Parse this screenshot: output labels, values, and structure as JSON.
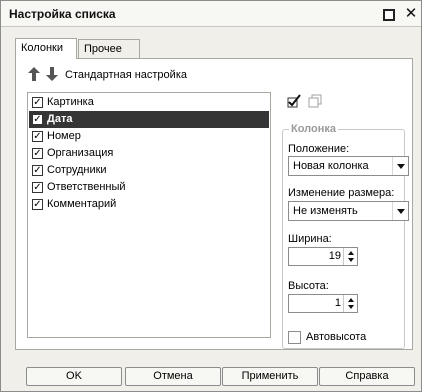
{
  "window": {
    "title": "Настройка списка",
    "maximize_icon": "maximize-icon",
    "close_icon": "close-icon",
    "close_glyph": "✕"
  },
  "tabs": [
    {
      "label": "Колонки",
      "active": true
    },
    {
      "label": "Прочее",
      "active": false
    }
  ],
  "toolbar": {
    "move_up_icon": "arrow-up-icon",
    "move_down_icon": "arrow-down-icon",
    "standard_settings_label": "Стандартная настройка"
  },
  "columns_list": {
    "items": [
      {
        "label": "Картинка",
        "checked": true,
        "selected": false
      },
      {
        "label": "Дата",
        "checked": true,
        "selected": true
      },
      {
        "label": "Номер",
        "checked": true,
        "selected": false
      },
      {
        "label": "Организация",
        "checked": true,
        "selected": false
      },
      {
        "label": "Сотрудники",
        "checked": true,
        "selected": false
      },
      {
        "label": "Ответственный",
        "checked": true,
        "selected": false
      },
      {
        "label": "Комментарий",
        "checked": true,
        "selected": false
      }
    ]
  },
  "column_panel": {
    "check_icon": "check-icon",
    "copy_icon": "copy-icon",
    "group_title": "Колонка",
    "position_label": "Положение:",
    "position_value": "Новая колонка",
    "resize_label": "Изменение размера:",
    "resize_value": "Не изменять",
    "width_label": "Ширина:",
    "width_value": "19",
    "height_label": "Высота:",
    "height_value": "1",
    "autoheight_label": "Автовысота",
    "autoheight_checked": false
  },
  "buttons": {
    "ok": "OK",
    "cancel": "Отмена",
    "apply": "Применить",
    "help": "Справка"
  },
  "colors": {
    "selection_bg": "#353535",
    "window_bg": "#f0efe9",
    "group_title": "#9a9a9a"
  }
}
